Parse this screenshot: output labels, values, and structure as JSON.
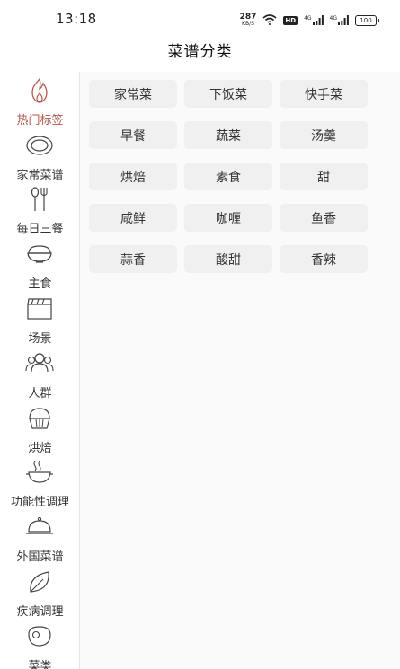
{
  "status_bar": {
    "time": "13:18",
    "net_speed": "287",
    "net_unit": "KB/S",
    "hd_badge": "HD",
    "signal1_label": "4G",
    "signal2_label": "4G",
    "battery": "100"
  },
  "header": {
    "title": "菜谱分类"
  },
  "colors": {
    "accent": "#b0574a",
    "chip_bg": "#f0f0f0",
    "divider": "#e6e6e6"
  },
  "sidebar": {
    "items": [
      {
        "label": "热门标签",
        "icon": "fire-icon",
        "active": true
      },
      {
        "label": "家常菜谱",
        "icon": "plate-icon"
      },
      {
        "label": "每日三餐",
        "icon": "fork-spoon-icon"
      },
      {
        "label": "主食",
        "icon": "rice-bowl-icon"
      },
      {
        "label": "场景",
        "icon": "clapperboard-icon"
      },
      {
        "label": "人群",
        "icon": "people-icon"
      },
      {
        "label": "烘焙",
        "icon": "bread-icon"
      },
      {
        "label": "功能性调理",
        "icon": "steaming-pot-icon"
      },
      {
        "label": "外国菜谱",
        "icon": "cloche-icon"
      },
      {
        "label": "疾病调理",
        "icon": "leaf-icon"
      },
      {
        "label": "菜类",
        "icon": "steak-icon"
      }
    ]
  },
  "tags": [
    [
      "家常菜",
      "下饭菜",
      "快手菜"
    ],
    [
      "早餐",
      "蔬菜",
      "汤羹"
    ],
    [
      "烘焙",
      "素食",
      "甜"
    ],
    [
      "咸鲜",
      "咖喱",
      "鱼香"
    ],
    [
      "蒜香",
      "酸甜",
      "香辣"
    ]
  ]
}
